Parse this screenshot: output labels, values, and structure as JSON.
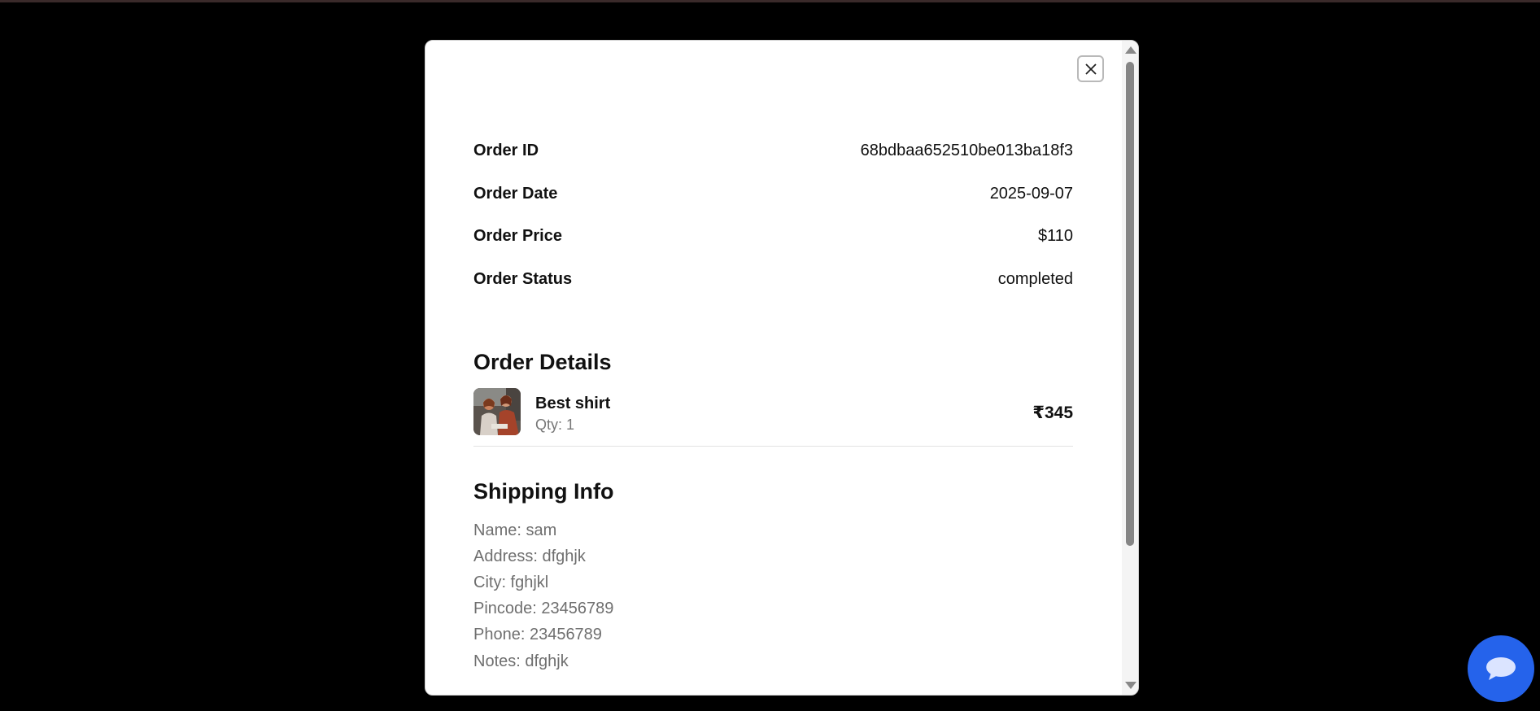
{
  "order": {
    "rows": [
      {
        "label": "Order ID",
        "value": "68bdbaa652510be013ba18f3"
      },
      {
        "label": "Order Date",
        "value": "2025-09-07"
      },
      {
        "label": "Order Price",
        "value": "$110"
      },
      {
        "label": "Order Status",
        "value": "completed"
      }
    ]
  },
  "details": {
    "title": "Order Details",
    "items": [
      {
        "name": "Best shirt",
        "qty": "Qty: 1",
        "price": "₹345"
      }
    ]
  },
  "shipping": {
    "title": "Shipping Info",
    "lines": [
      "Name: sam",
      "Address: dfghjk",
      "City: fghjkl",
      "Pincode: 23456789",
      "Phone: 23456789",
      "Notes: dfghjk"
    ]
  },
  "icons": {
    "close": "close-icon",
    "chat": "chat-icon"
  },
  "colors": {
    "chat_button": "#2563eb",
    "background": "#000000",
    "modal": "#ffffff"
  }
}
